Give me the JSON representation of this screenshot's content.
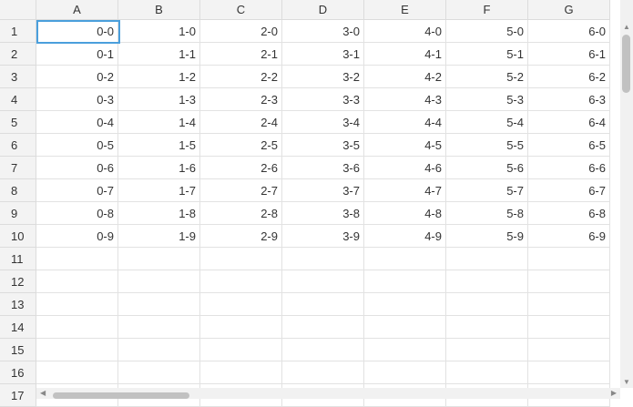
{
  "columns": [
    "A",
    "B",
    "C",
    "D",
    "E",
    "F",
    "G"
  ],
  "rows": [
    "1",
    "2",
    "3",
    "4",
    "5",
    "6",
    "7",
    "8",
    "9",
    "10",
    "11",
    "12",
    "13",
    "14",
    "15",
    "16",
    "17"
  ],
  "cells": [
    [
      "0-0",
      "1-0",
      "2-0",
      "3-0",
      "4-0",
      "5-0",
      "6-0"
    ],
    [
      "0-1",
      "1-1",
      "2-1",
      "3-1",
      "4-1",
      "5-1",
      "6-1"
    ],
    [
      "0-2",
      "1-2",
      "2-2",
      "3-2",
      "4-2",
      "5-2",
      "6-2"
    ],
    [
      "0-3",
      "1-3",
      "2-3",
      "3-3",
      "4-3",
      "5-3",
      "6-3"
    ],
    [
      "0-4",
      "1-4",
      "2-4",
      "3-4",
      "4-4",
      "5-4",
      "6-4"
    ],
    [
      "0-5",
      "1-5",
      "2-5",
      "3-5",
      "4-5",
      "5-5",
      "6-5"
    ],
    [
      "0-6",
      "1-6",
      "2-6",
      "3-6",
      "4-6",
      "5-6",
      "6-6"
    ],
    [
      "0-7",
      "1-7",
      "2-7",
      "3-7",
      "4-7",
      "5-7",
      "6-7"
    ],
    [
      "0-8",
      "1-8",
      "2-8",
      "3-8",
      "4-8",
      "5-8",
      "6-8"
    ],
    [
      "0-9",
      "1-9",
      "2-9",
      "3-9",
      "4-9",
      "5-9",
      "6-9"
    ],
    [
      "",
      "",
      "",
      "",
      "",
      "",
      ""
    ],
    [
      "",
      "",
      "",
      "",
      "",
      "",
      ""
    ],
    [
      "",
      "",
      "",
      "",
      "",
      "",
      ""
    ],
    [
      "",
      "",
      "",
      "",
      "",
      "",
      ""
    ],
    [
      "",
      "",
      "",
      "",
      "",
      "",
      ""
    ],
    [
      "",
      "",
      "",
      "",
      "",
      "",
      ""
    ],
    [
      "",
      "",
      "",
      "",
      "",
      "",
      ""
    ]
  ],
  "selected_cell": "A1",
  "selection_color": "#4a9fdc",
  "icons": {
    "scroll_up": "▲",
    "scroll_down": "▼",
    "scroll_left": "◀",
    "scroll_right": "▶"
  }
}
